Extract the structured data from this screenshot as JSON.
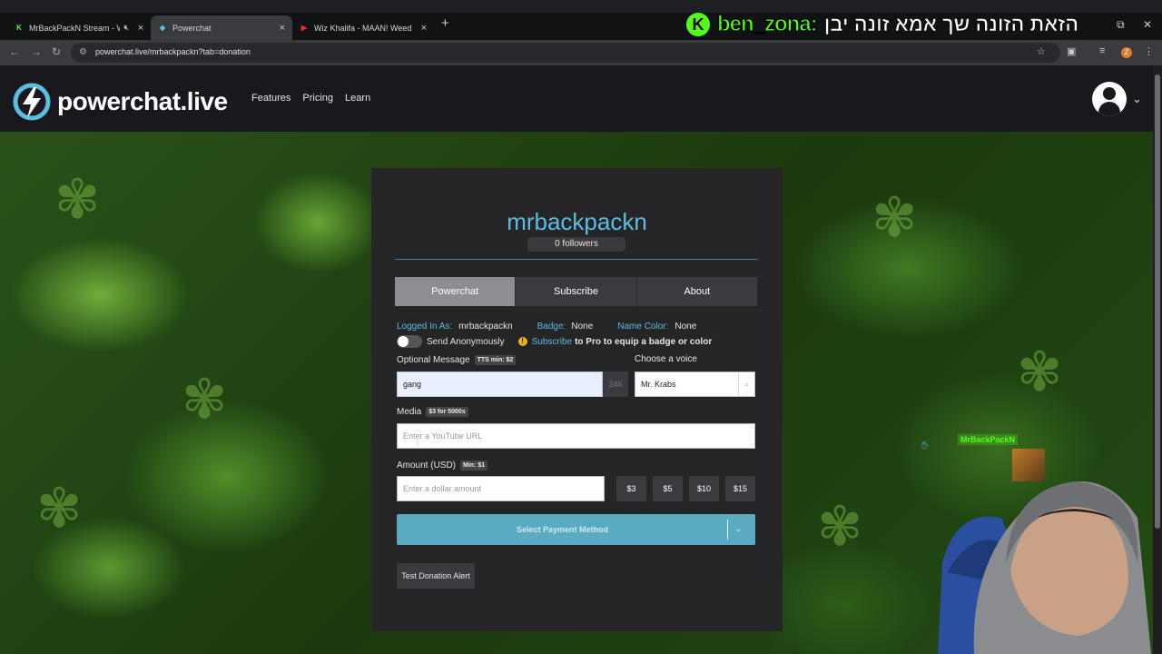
{
  "browser": {
    "tabs": [
      {
        "label": "MrBackPackN Stream - Wa",
        "favicon": "kick-icon",
        "active": false
      },
      {
        "label": "Powerchat",
        "favicon": "powerchat-icon",
        "active": true
      },
      {
        "label": "Wiz Khalifa - MAAN! Weedmix",
        "favicon": "youtube-icon",
        "active": false
      }
    ],
    "url": "powerchat.live/mrbackpackn?tab=donation",
    "profile_initial": "Z"
  },
  "overlay": {
    "badge": "K",
    "username": "ben_zona:",
    "message": "הזאת הזונה שך אמא זונה יבן"
  },
  "site": {
    "brand": "powerchat.live",
    "nav": [
      "Features",
      "Pricing",
      "Learn"
    ]
  },
  "card": {
    "username": "mrbackpackn",
    "followers": "0 followers",
    "tabs": [
      "Powerchat",
      "Subscribe",
      "About"
    ],
    "logged_in_label": "Logged In As:",
    "logged_in_value": "mrbackpackn",
    "badge_label": "Badge:",
    "badge_value": "None",
    "name_color_label": "Name Color:",
    "name_color_value": "None",
    "anon_label": "Send Anonymously",
    "subscribe_link": "Subscribe",
    "subscribe_text": "to Pro to equip a badge or color",
    "message_label": "Optional Message",
    "message_pill": "TTS min: $2",
    "message_value": "gang",
    "message_count": "246",
    "voice_label": "Choose a voice",
    "voice_value": "Mr. Krabs",
    "media_label": "Media",
    "media_pill": "$3 for 5000s",
    "media_placeholder": "Enter a YouTube URL",
    "amount_label": "Amount (USD)",
    "amount_pill": "Min: $1",
    "amount_placeholder": "Enter a dollar amount",
    "amount_buttons": [
      "$3",
      "$5",
      "$10",
      "$15"
    ],
    "pay_button": "Select Payment Method",
    "test_button": "Test Donation Alert"
  },
  "webcam": {
    "overlay_name": "MrBackPackN"
  },
  "colors": {
    "accent": "#5bbde0",
    "kick_green": "#53fc18",
    "pay_button": "#5aabc2"
  }
}
